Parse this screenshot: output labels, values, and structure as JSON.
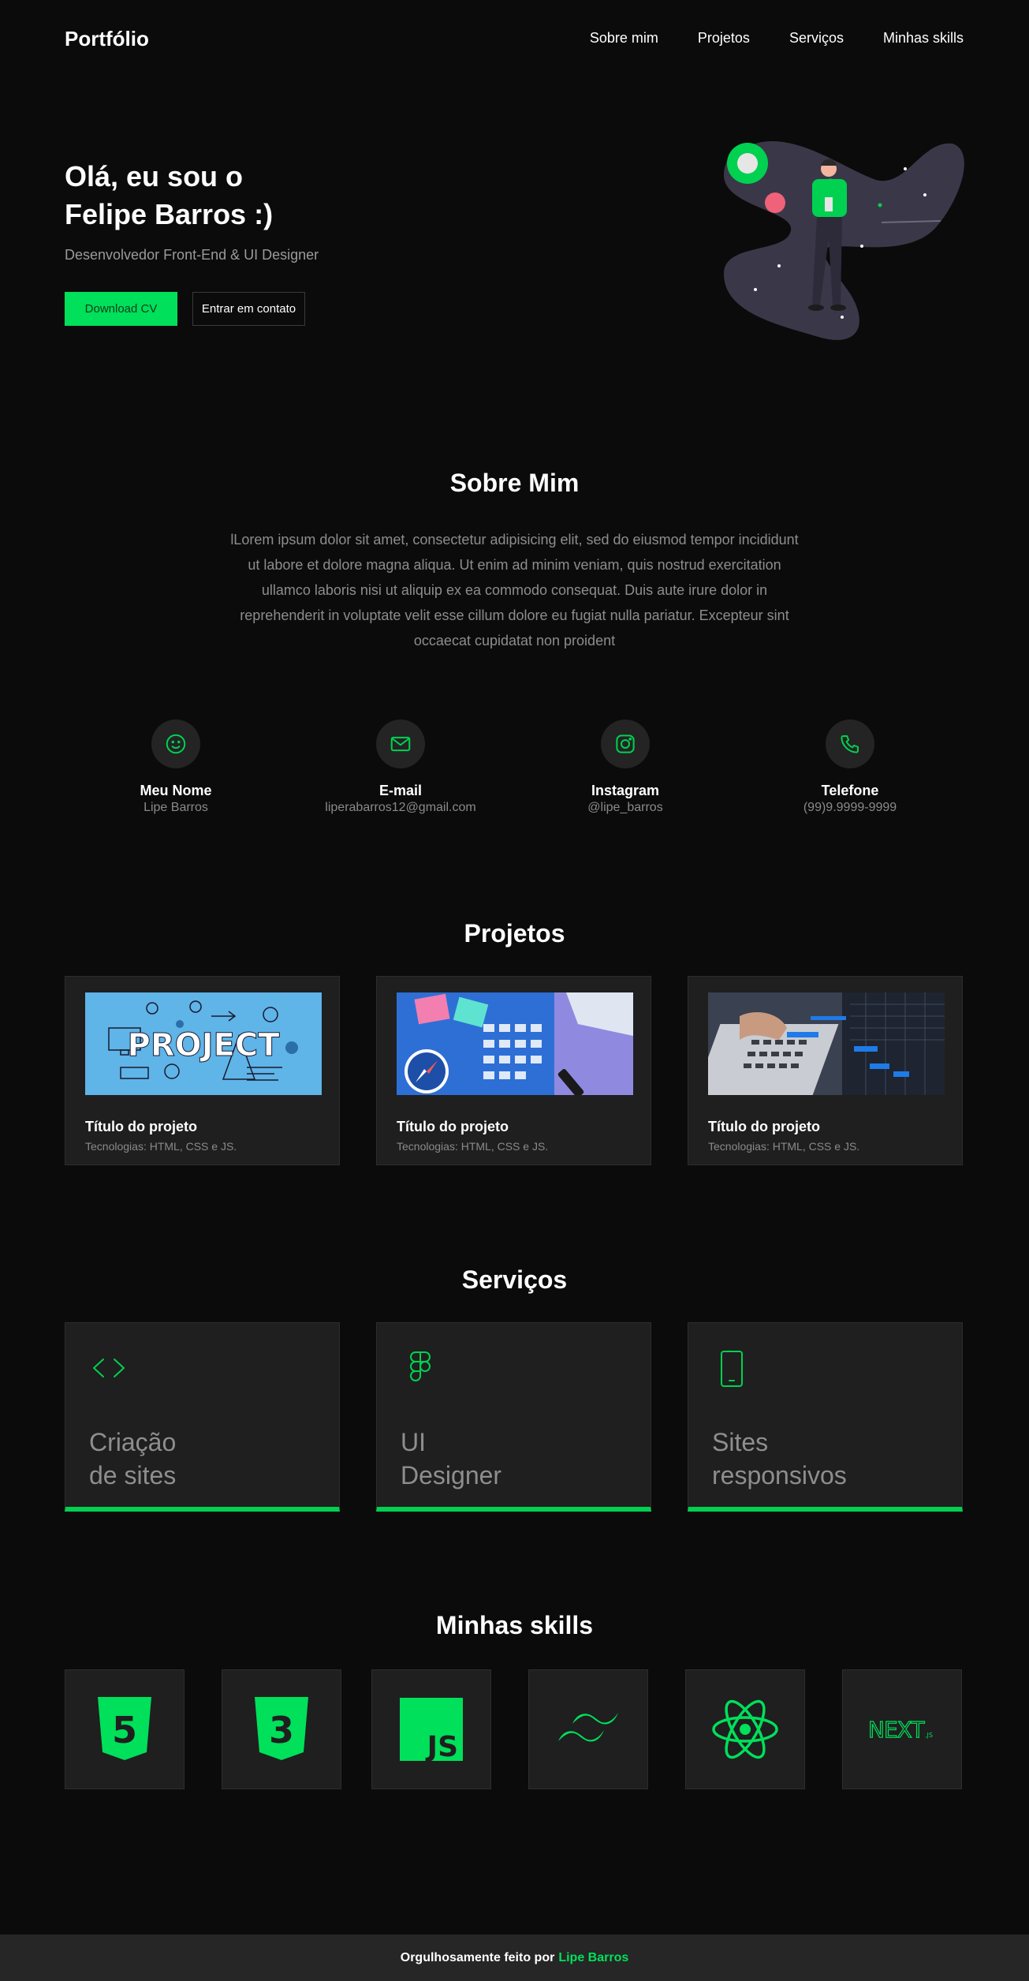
{
  "header": {
    "logo": "Portfólio",
    "nav": [
      "Sobre mim",
      "Projetos",
      "Serviços",
      "Minhas skills"
    ]
  },
  "hero": {
    "title_line1": "Olá, eu sou o",
    "title_line2": "Felipe Barros :)",
    "subtitle": "Desenvolvedor Front-End & UI Designer",
    "download_button": "Download CV",
    "contact_button": "Entrar em contato"
  },
  "about": {
    "title": "Sobre Mim",
    "text": "lLorem ipsum dolor sit amet, consectetur adipisicing elit, sed do eiusmod tempor incididunt ut labore et dolore magna aliqua. Ut enim ad minim veniam, quis nostrud exercitation ullamco laboris nisi ut aliquip ex ea commodo consequat. Duis aute irure dolor in reprehenderit in voluptate velit esse cillum dolore eu fugiat nulla pariatur. Excepteur sint occaecat cupidatat non proident",
    "contacts": [
      {
        "icon": "smile-icon",
        "label": "Meu Nome",
        "value": "Lipe Barros"
      },
      {
        "icon": "mail-icon",
        "label": "E-mail",
        "value": "liperabarros12@gmail.com"
      },
      {
        "icon": "instagram-icon",
        "label": "Instagram",
        "value": "@lipe_barros"
      },
      {
        "icon": "phone-icon",
        "label": "Telefone",
        "value": "(99)9.9999-9999"
      }
    ]
  },
  "projects": {
    "title": "Projetos",
    "items": [
      {
        "title": "Título do projeto",
        "tech": "Tecnologias: HTML, CSS e JS.",
        "thumb_text": "PROJECT"
      },
      {
        "title": "Título do projeto",
        "tech": "Tecnologias: HTML, CSS e JS."
      },
      {
        "title": "Título do projeto",
        "tech": "Tecnologias: HTML, CSS e JS."
      }
    ]
  },
  "services": {
    "title": "Serviços",
    "items": [
      {
        "icon": "code-icon",
        "line1": "Criação",
        "line2": "de sites"
      },
      {
        "icon": "figma-icon",
        "line1": "UI",
        "line2": "Designer"
      },
      {
        "icon": "tablet-icon",
        "line1": "Sites",
        "line2": "responsivos"
      }
    ]
  },
  "skills": {
    "title": "Minhas skills",
    "items": [
      {
        "icon": "html5-icon",
        "text": "5"
      },
      {
        "icon": "css3-icon",
        "text": "3"
      },
      {
        "icon": "javascript-icon",
        "text": "JS"
      },
      {
        "icon": "tailwind-icon"
      },
      {
        "icon": "react-icon"
      },
      {
        "icon": "nextjs-icon",
        "text": "NEXT",
        "suffix": ".JS"
      }
    ]
  },
  "footer": {
    "text": "Orgulhosamente feito por",
    "author": "Lipe Barros"
  },
  "colors": {
    "accent": "#00e05a",
    "background": "#0b0b0b",
    "card": "#1f1f1f"
  }
}
